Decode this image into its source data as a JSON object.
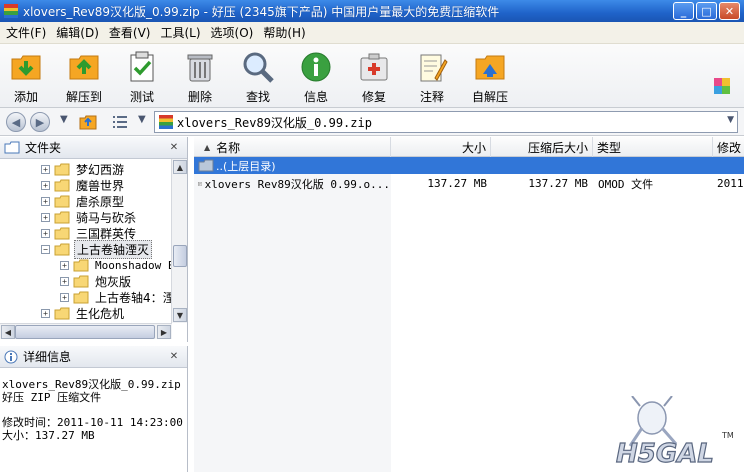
{
  "window": {
    "title": "xlovers_Rev89汉化版_0.99.zip - 好压 (2345旗下产品) 中国用户量最大的免费压缩软件",
    "minimize": "_",
    "maximize": "□",
    "close": "✕"
  },
  "menu": [
    "文件(F)",
    "编辑(D)",
    "查看(V)",
    "工具(L)",
    "选项(O)",
    "帮助(H)"
  ],
  "toolbar": {
    "add": "添加",
    "extract_to": "解压到",
    "test": "测试",
    "delete": "删除",
    "find": "查找",
    "info": "信息",
    "repair": "修复",
    "comment": "注释",
    "sfx": "自解压"
  },
  "address": {
    "path": "xlovers_Rev89汉化版_0.99.zip"
  },
  "folder_panel": {
    "title": "文件夹",
    "items": [
      {
        "label": "梦幻西游"
      },
      {
        "label": "魔兽世界"
      },
      {
        "label": "虐杀原型"
      },
      {
        "label": "骑马与砍杀"
      },
      {
        "label": "三国群英传"
      },
      {
        "label": "上古卷轴湮灭"
      },
      {
        "label": "Moonshadow E"
      },
      {
        "label": "炮灰版"
      },
      {
        "label": "上古卷轴4：湮"
      },
      {
        "label": "生化危机"
      }
    ]
  },
  "details_panel": {
    "title": "详细信息",
    "filename": "xlovers_Rev89汉化版_0.99.zip",
    "filetype": "好压 ZIP 压缩文件",
    "modified": "修改时间：2011-10-11 14:23:00",
    "size": "大小：137.27 MB"
  },
  "file_list": {
    "columns": {
      "name": "名称",
      "size": "大小",
      "packed": "压缩后大小",
      "type": "类型",
      "modified": "修改"
    },
    "parent_row": "..(上层目录)",
    "rows": [
      {
        "name": "xlovers Rev89汉化版 0.99.o...",
        "size": "137.27 MB",
        "packed": "137.27 MB",
        "type": "OMOD 文件",
        "modified": "2011"
      }
    ]
  },
  "colors": {
    "titlebar": "#1f63c9",
    "selection": "#3176d8",
    "menubar": "#f3f1e8"
  },
  "watermark": {
    "text": "H5GAL",
    "tm": "TM"
  }
}
